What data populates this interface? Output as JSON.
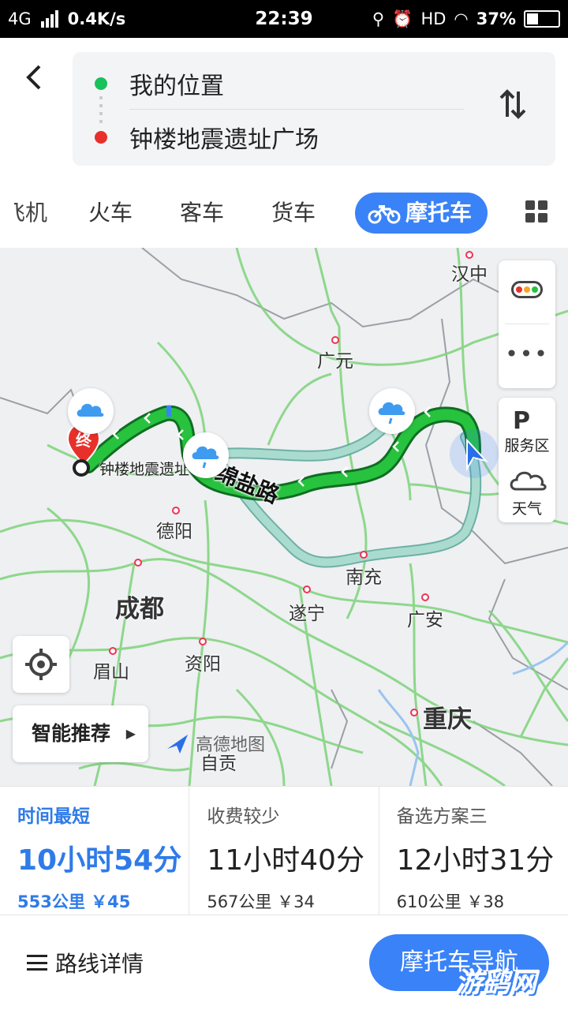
{
  "status_bar": {
    "network": "4G",
    "speed": "0.4K/s",
    "time": "22:39",
    "hd": "HD",
    "battery": "37%"
  },
  "route": {
    "origin": "我的位置",
    "destination": "钟楼地震遗址广场"
  },
  "tabs": [
    {
      "label": "飞机"
    },
    {
      "label": "火车"
    },
    {
      "label": "客车"
    },
    {
      "label": "货车"
    },
    {
      "label": "摩托车",
      "active": true
    }
  ],
  "map": {
    "cities": [
      {
        "name": "汉中"
      },
      {
        "name": "广元"
      },
      {
        "name": "德阳"
      },
      {
        "name": "南充"
      },
      {
        "name": "成都"
      },
      {
        "name": "遂宁"
      },
      {
        "name": "广安"
      },
      {
        "name": "眉山"
      },
      {
        "name": "资阳"
      },
      {
        "name": "重庆"
      }
    ],
    "destination_label": "钟楼地震遗址",
    "end_marker": "终",
    "road_label": "绵盐路",
    "logo": "高德地图",
    "logo_sub": "自贡",
    "side": {
      "service": "服务区",
      "weather": "天气"
    },
    "recommend_label": "智能推荐"
  },
  "route_options": [
    {
      "name": "时间最短",
      "time": "10小时54分",
      "meta": "553公里 ￥45",
      "active": true
    },
    {
      "name": "收费较少",
      "time": "11小时40分",
      "meta": "567公里 ￥34"
    },
    {
      "name": "备选方案三",
      "time": "12小时31分",
      "meta": "610公里 ￥38"
    }
  ],
  "footer": {
    "details": "路线详情",
    "navigate": "摩托车导航",
    "watermark": "游鹞网"
  },
  "colors": {
    "accent": "#3a82f7",
    "route_main": "#1ea83a",
    "route_alt": "#8ed1c4"
  }
}
